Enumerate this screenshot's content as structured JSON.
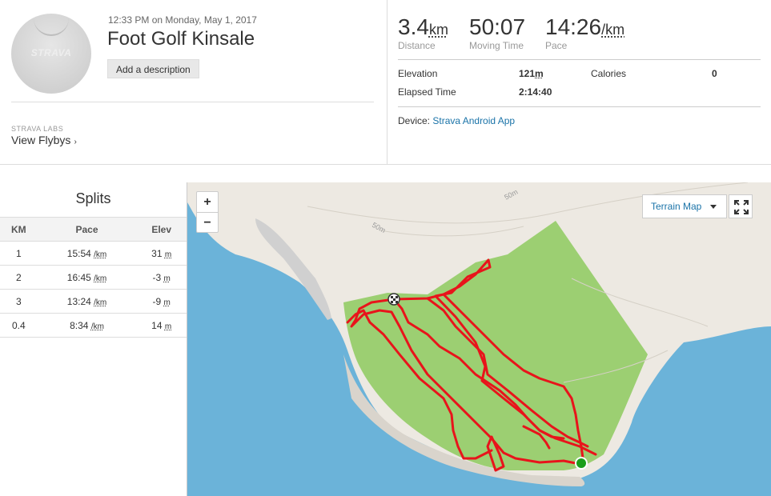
{
  "header": {
    "datetime": "12:33 PM on Monday, May 1, 2017",
    "title": "Foot Golf Kinsale",
    "add_description": "Add a description",
    "avatar_logo": "STRAVA",
    "labs_label": "STRAVA LABS",
    "flybys_label": "View Flybys",
    "flybys_chevron": "›"
  },
  "stats": {
    "distance": {
      "value": "3.4",
      "unit": "km",
      "label": "Distance"
    },
    "moving_time": {
      "value": "50:07",
      "label": "Moving Time"
    },
    "pace": {
      "value": "14:26",
      "unit": "/km",
      "label": "Pace"
    },
    "elevation_label": "Elevation",
    "elevation_value": "121",
    "elevation_unit": "m",
    "calories_label": "Calories",
    "calories_value": "0",
    "elapsed_label": "Elapsed Time",
    "elapsed_value": "2:14:40",
    "device_label": "Device:",
    "device_value": "Strava Android App"
  },
  "splits": {
    "title": "Splits",
    "columns": [
      "KM",
      "Pace",
      "Elev"
    ],
    "pace_unit": "/km",
    "elev_unit": "m",
    "rows": [
      {
        "km": "1",
        "pace": "15:54",
        "elev": "31"
      },
      {
        "km": "2",
        "pace": "16:45",
        "elev": "-3"
      },
      {
        "km": "3",
        "pace": "13:24",
        "elev": "-9"
      },
      {
        "km": "0.4",
        "pace": "8:34",
        "elev": "14"
      }
    ]
  },
  "map": {
    "zoom_in": "+",
    "zoom_out": "−",
    "layer_select": "Terrain Map",
    "contour_label_1": "50m",
    "contour_label_2": "50m",
    "colors": {
      "water": "#6bb3d9",
      "land": "#ede9e2",
      "park": "#9ccf72",
      "route": "#e8141b",
      "start": "#1a9e1a"
    }
  }
}
